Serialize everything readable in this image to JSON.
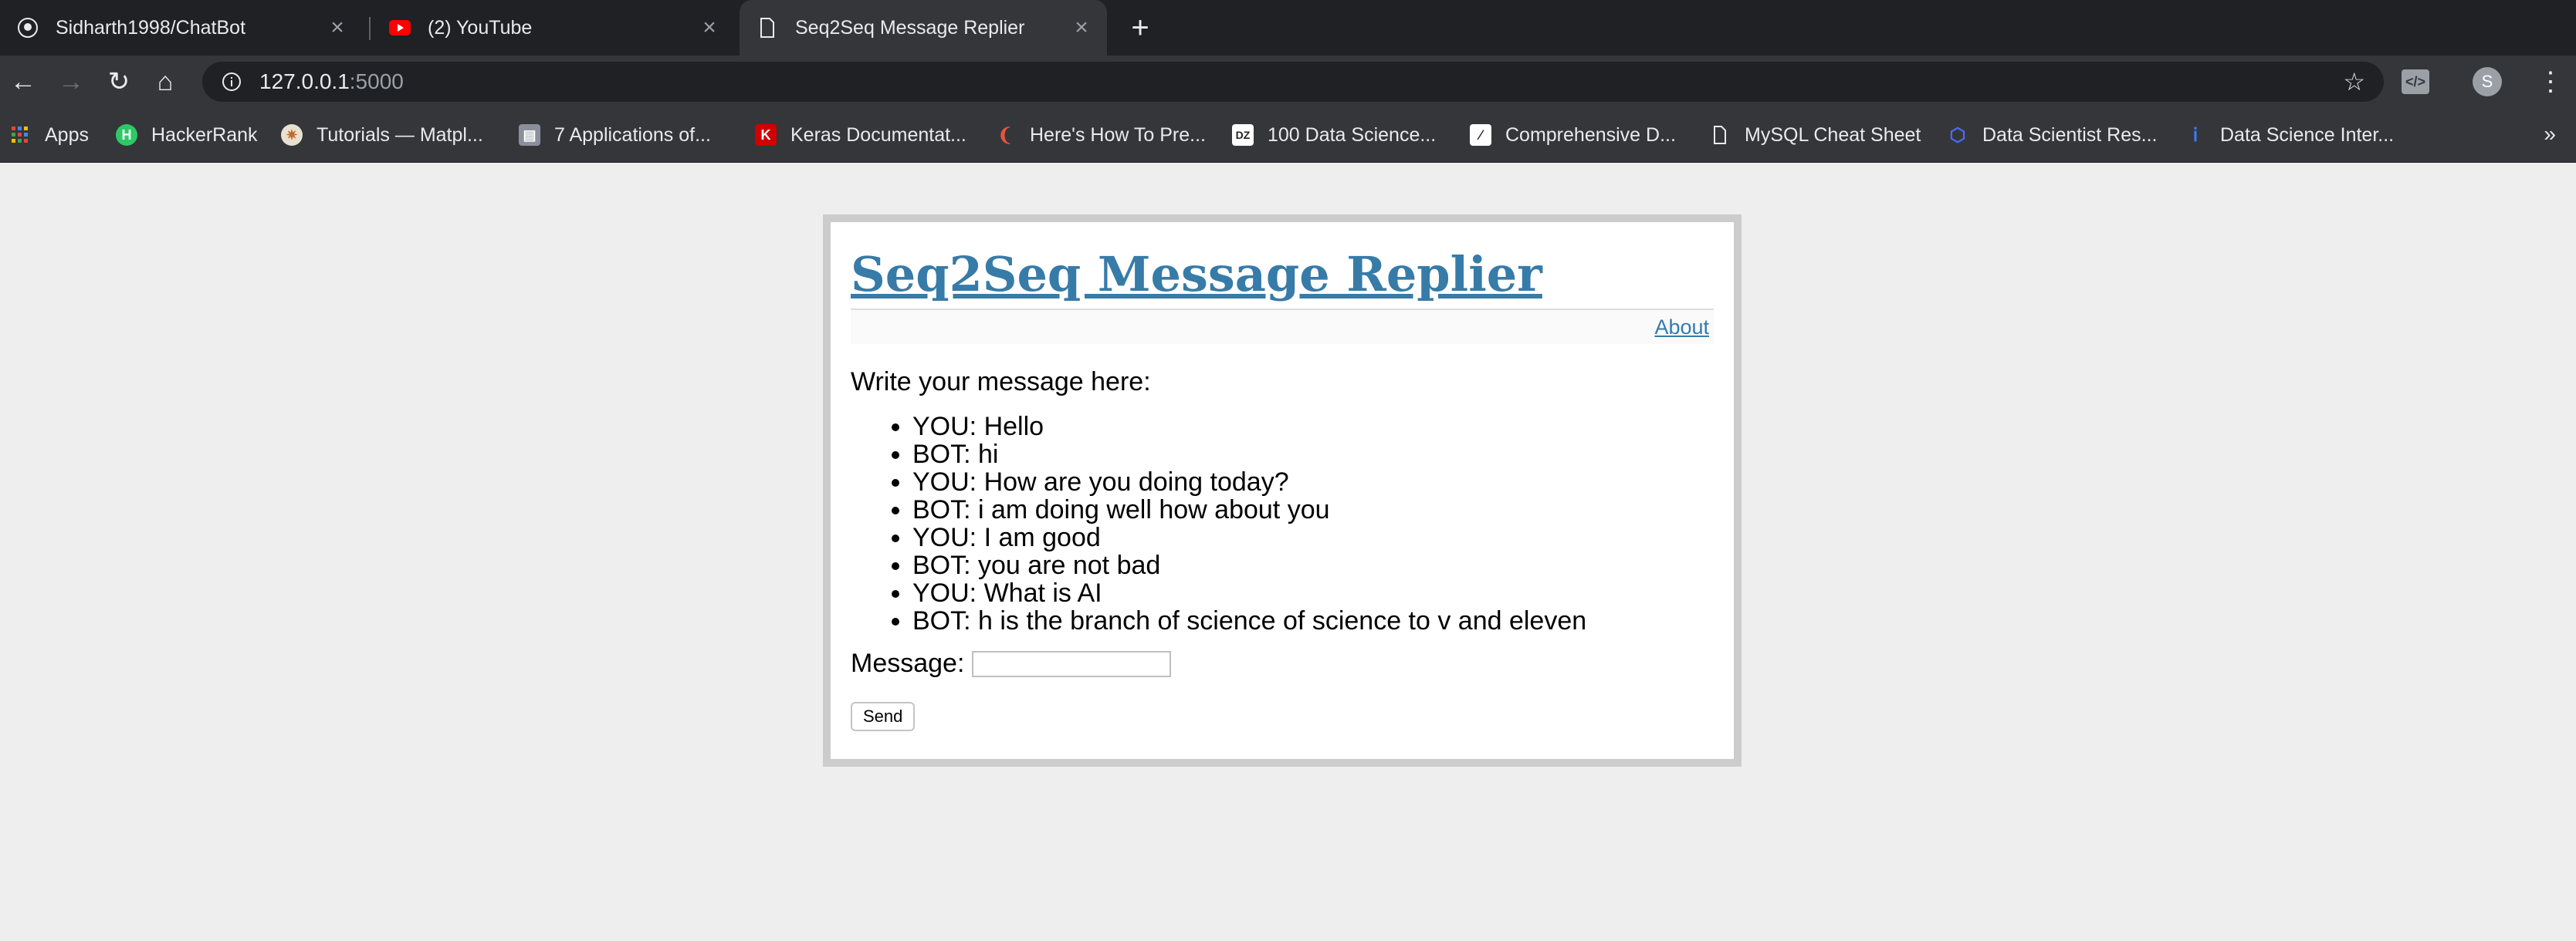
{
  "browser": {
    "tabs": [
      {
        "title": "Sidharth1998/ChatBot",
        "icon": "github-icon"
      },
      {
        "title": "(2) YouTube",
        "icon": "youtube-icon"
      },
      {
        "title": "Seq2Seq Message Replier",
        "icon": "page-icon"
      }
    ],
    "new_tab": "+",
    "url_host": "127.0.0.1",
    "url_port": ":5000",
    "avatar_letter": "S",
    "bookmarks": [
      {
        "label": "Apps",
        "icon": "apps-grid-icon"
      },
      {
        "label": "HackerRank",
        "icon": "hackerrank-icon"
      },
      {
        "label": "Tutorials — Matpl...",
        "icon": "matplotlib-icon"
      },
      {
        "label": "7 Applications of...",
        "icon": "article-icon"
      },
      {
        "label": "Keras Documentat...",
        "icon": "keras-icon"
      },
      {
        "label": "Here's How To Pre...",
        "icon": "bookmark-icon"
      },
      {
        "label": "100 Data Science...",
        "icon": "dzone-icon"
      },
      {
        "label": "Comprehensive D...",
        "icon": "chart-icon"
      },
      {
        "label": "MySQL Cheat Sheet",
        "icon": "page-icon"
      },
      {
        "label": "Data Scientist Res...",
        "icon": "datasci-icon"
      },
      {
        "label": "Data Science Inter...",
        "icon": "info-icon"
      }
    ],
    "more": "»"
  },
  "app": {
    "title": "Seq2Seq Message Replier",
    "nav_about": "About",
    "prompt": "Write your message here:",
    "conversation": [
      "YOU: Hello",
      "BOT: hi",
      "YOU: How are you doing today?",
      "BOT: i am doing well how about you",
      "YOU: I am good",
      "BOT: you are not bad",
      "YOU: What is AI",
      "BOT: h is the branch of science of science to v and eleven"
    ],
    "message_label": "Message:",
    "message_value": "",
    "send_label": "Send"
  },
  "colors": {
    "link": "#377ba8",
    "chrome_dark": "#202124",
    "chrome_tab": "#35363a"
  }
}
